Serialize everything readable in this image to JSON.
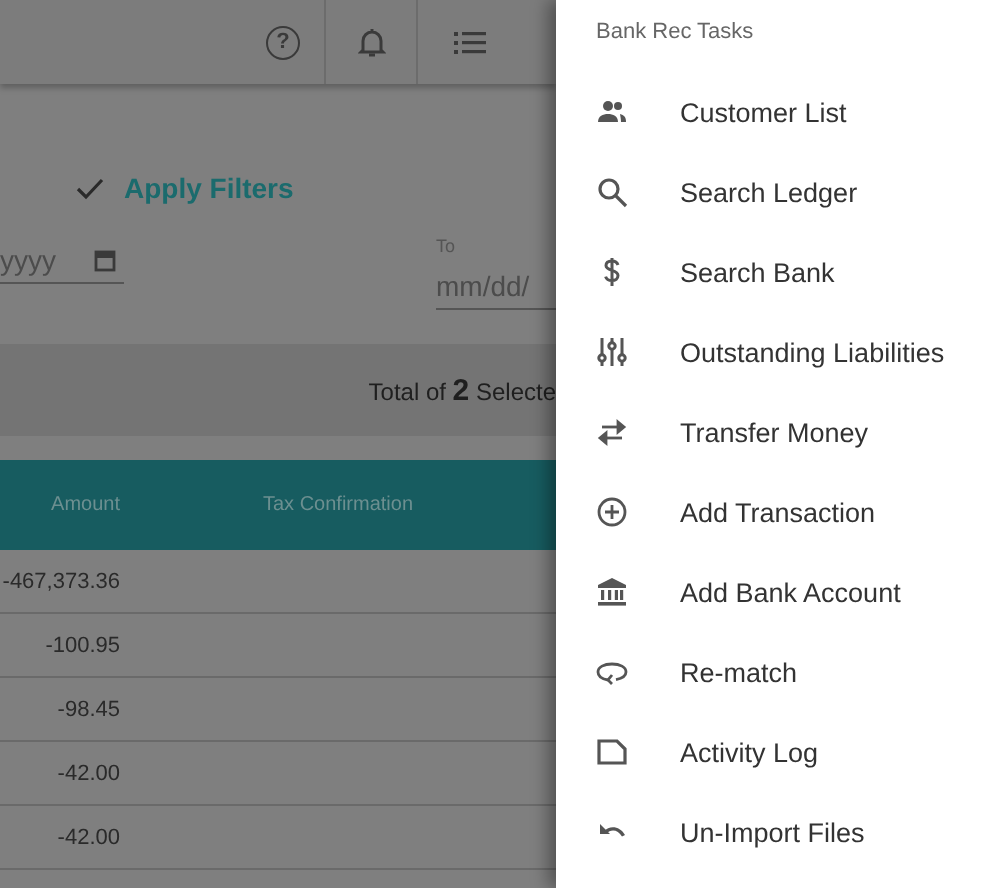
{
  "toolbar": {
    "help": "?"
  },
  "filters": {
    "apply_label": "Apply Filters",
    "from_placeholder": "yyyy",
    "to_label": "To",
    "to_placeholder": "mm/dd/"
  },
  "summary": {
    "text": "Total of **2** Selecte"
  },
  "table": {
    "columns": [
      "Amount",
      "Tax Confirmation"
    ],
    "rows": [
      {
        "amount": "-467,373.36"
      },
      {
        "amount": "-100.95"
      },
      {
        "amount": "-98.45"
      },
      {
        "amount": "-42.00"
      },
      {
        "amount": "-42.00"
      }
    ]
  },
  "drawer": {
    "title": "Bank Rec Tasks",
    "items": [
      {
        "label": "Customer List"
      },
      {
        "label": "Search Ledger"
      },
      {
        "label": "Search Bank"
      },
      {
        "label": "Outstanding Liabilities"
      },
      {
        "label": "Transfer Money"
      },
      {
        "label": "Add Transaction"
      },
      {
        "label": "Add Bank Account"
      },
      {
        "label": "Re-match"
      },
      {
        "label": "Activity Log"
      },
      {
        "label": "Un-Import Files"
      }
    ]
  }
}
